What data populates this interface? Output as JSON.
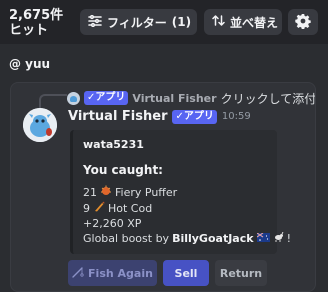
{
  "toolbar": {
    "hits_label": "2,675件ヒット",
    "filter_label": "フィルター",
    "filter_count": "(1)",
    "sort_label": "並べ替え"
  },
  "channel": {
    "mention": "@ yuu"
  },
  "reply": {
    "badge": "✓アプリ",
    "author": "Virtual Fisher",
    "text": "クリックして添付"
  },
  "message": {
    "author": "Virtual Fisher",
    "badge": "✓アプリ",
    "time": "10:59"
  },
  "embed": {
    "author": "wata5231",
    "title": "You caught:",
    "catch1_qty": "21",
    "catch1_name": "Fiery Puffer",
    "catch2_qty": "9",
    "catch2_name": "Hot Cod",
    "xp": "+2,260 XP",
    "boost_prefix": "Global boost by",
    "boost_user": "BillyGoatJack"
  },
  "buttons": {
    "fish_again": "Fish Again",
    "sell": "Sell",
    "return": "Return"
  },
  "colors": {
    "background": "#2b2d31",
    "toolbar": "#232428",
    "blurple": "#5865f2",
    "sell": "#4752c4"
  }
}
